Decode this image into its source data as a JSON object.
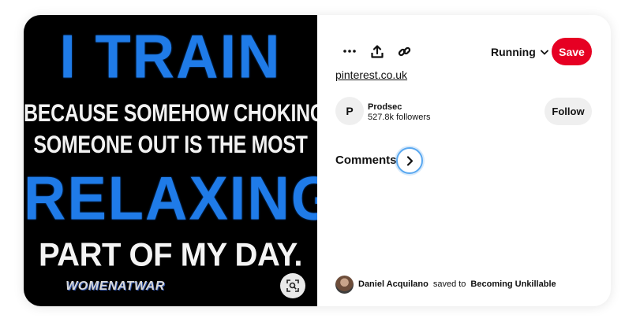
{
  "pin_image": {
    "headline_top": "I TRAIN",
    "line_1": "BECAUSE SOMEHOW CHOKING",
    "line_2": "SOMEONE OUT IS THE MOST",
    "headline_mid": "RELAXING",
    "line_3": "PART OF MY DAY.",
    "watermark": "WOMENATWAR",
    "colors": {
      "blue_text": "#1f7be8",
      "background": "#000000"
    },
    "lens_icon": "visual-search-icon"
  },
  "toolbar": {
    "more_icon": "more-options-icon",
    "share_icon": "share-icon",
    "link_icon": "link-icon",
    "board_name": "Running",
    "save_label": "Save",
    "save_color": "#e60023"
  },
  "source": {
    "domain": "pinterest.co.uk"
  },
  "creator": {
    "initial": "P",
    "name": "Prodsec",
    "followers": "527.8k followers",
    "follow_label": "Follow"
  },
  "comments": {
    "title": "Comments"
  },
  "saved_by": {
    "user": "Daniel Acquilano",
    "action": "saved to",
    "board": "Becoming Unkillable"
  }
}
